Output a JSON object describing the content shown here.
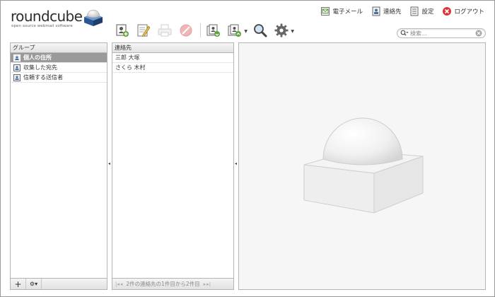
{
  "brand": {
    "name": "roundcube",
    "tagline": "open source webmail software"
  },
  "topnav": [
    {
      "label": "電子メール",
      "icon": "mail-icon"
    },
    {
      "label": "連絡先",
      "icon": "addressbook-icon"
    },
    {
      "label": "設定",
      "icon": "settings-icon"
    },
    {
      "label": "ログアウト",
      "icon": "logout-icon"
    }
  ],
  "toolbar": {
    "buttons": [
      {
        "name": "create-contact",
        "icon": "add-contact-icon",
        "enabled": true
      },
      {
        "name": "compose-to-contact",
        "icon": "compose-icon",
        "enabled": true
      },
      {
        "name": "print-contact",
        "icon": "print-icon",
        "enabled": false
      },
      {
        "name": "delete-contact",
        "icon": "delete-icon",
        "enabled": false
      },
      {
        "name": "import-contacts",
        "icon": "import-icon",
        "enabled": true
      },
      {
        "name": "export-contacts",
        "icon": "export-icon",
        "enabled": true,
        "has_menu": true
      },
      {
        "name": "advanced-search",
        "icon": "magnifier-icon",
        "enabled": true
      },
      {
        "name": "contact-options",
        "icon": "gear-icon",
        "enabled": true,
        "has_menu": true
      }
    ]
  },
  "search": {
    "placeholder": "検索..."
  },
  "groups": {
    "header": "グループ",
    "items": [
      {
        "label": "個人の住所",
        "selected": true
      },
      {
        "label": "収集した宛先",
        "selected": false
      },
      {
        "label": "信頼する送信者",
        "selected": false
      }
    ],
    "footer_add": "+",
    "footer_menu": "⚙▾"
  },
  "contacts": {
    "header": "連絡先",
    "items": [
      {
        "name": "三郎 大塚"
      },
      {
        "name": "さくら 木村"
      }
    ],
    "pager_text": "2件の連絡先の1件目から2件目"
  },
  "colors": {
    "selected_row": "#9a9a9a",
    "panel_border": "#b4b4b4",
    "preview_bg": "#f6f6f6"
  }
}
